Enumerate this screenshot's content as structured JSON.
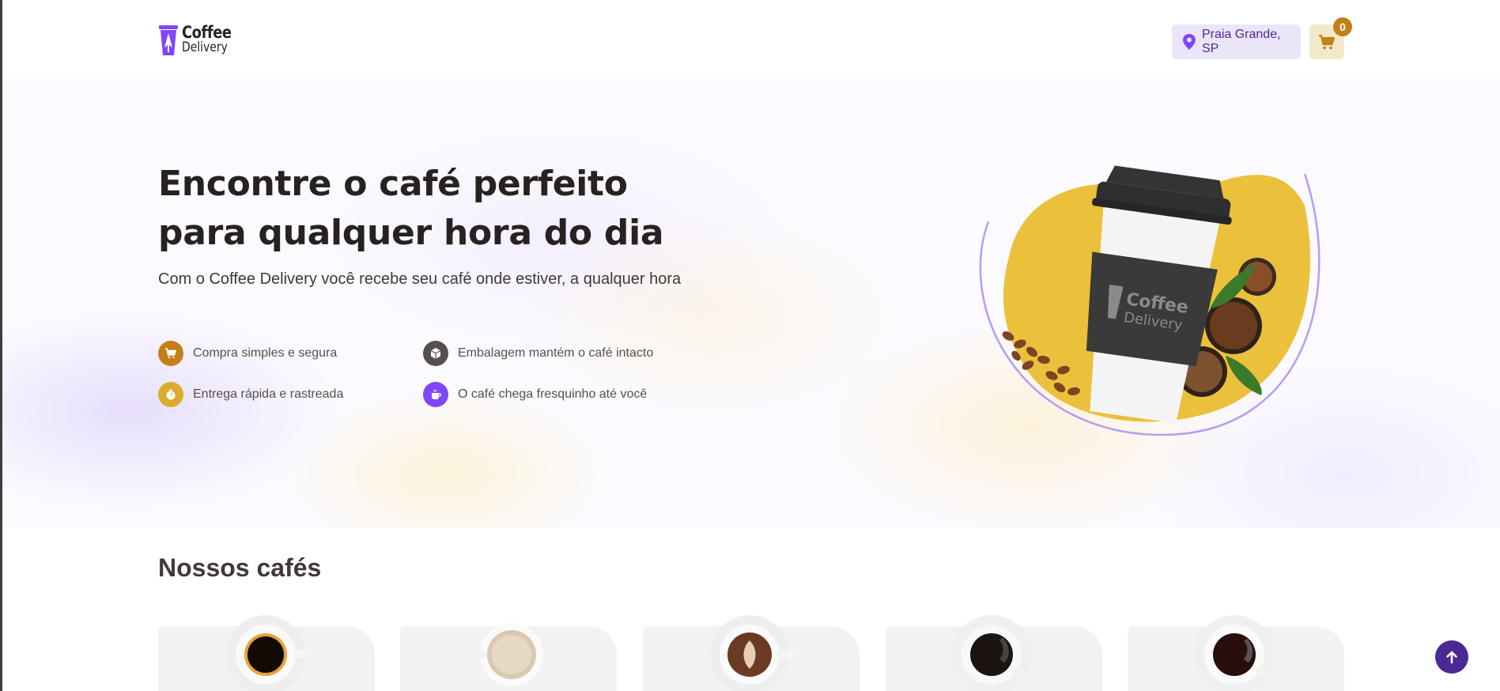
{
  "header": {
    "logo": {
      "line1": "Coffee",
      "line2": "Delivery"
    },
    "location": "Praia Grande, SP",
    "cart_count": "0"
  },
  "hero": {
    "title_line1": "Encontre o café perfeito",
    "title_line2": "para qualquer hora do dia",
    "subtitle": "Com o Coffee Delivery você recebe seu café onde estiver, a qualquer hora",
    "features": [
      {
        "label": "Compra simples e segura",
        "icon": "cart-icon",
        "color": "#C47F17"
      },
      {
        "label": "Embalagem mantém o café intacto",
        "icon": "package-icon",
        "color": "#574F4D"
      },
      {
        "label": "Entrega rápida e rastreada",
        "icon": "timer-icon",
        "color": "#DBAC2C"
      },
      {
        "label": "O café chega fresquinho até você",
        "icon": "coffee-icon",
        "color": "#8047F8"
      }
    ],
    "cup_brand": {
      "line1": "Coffee",
      "line2": "Delivery"
    }
  },
  "catalog": {
    "title": "Nossos cafés"
  },
  "colors": {
    "purple": "#8047F8",
    "purple_dark": "#4B2995",
    "yellow": "#DBAC2C",
    "yellow_dark": "#C47F17"
  }
}
